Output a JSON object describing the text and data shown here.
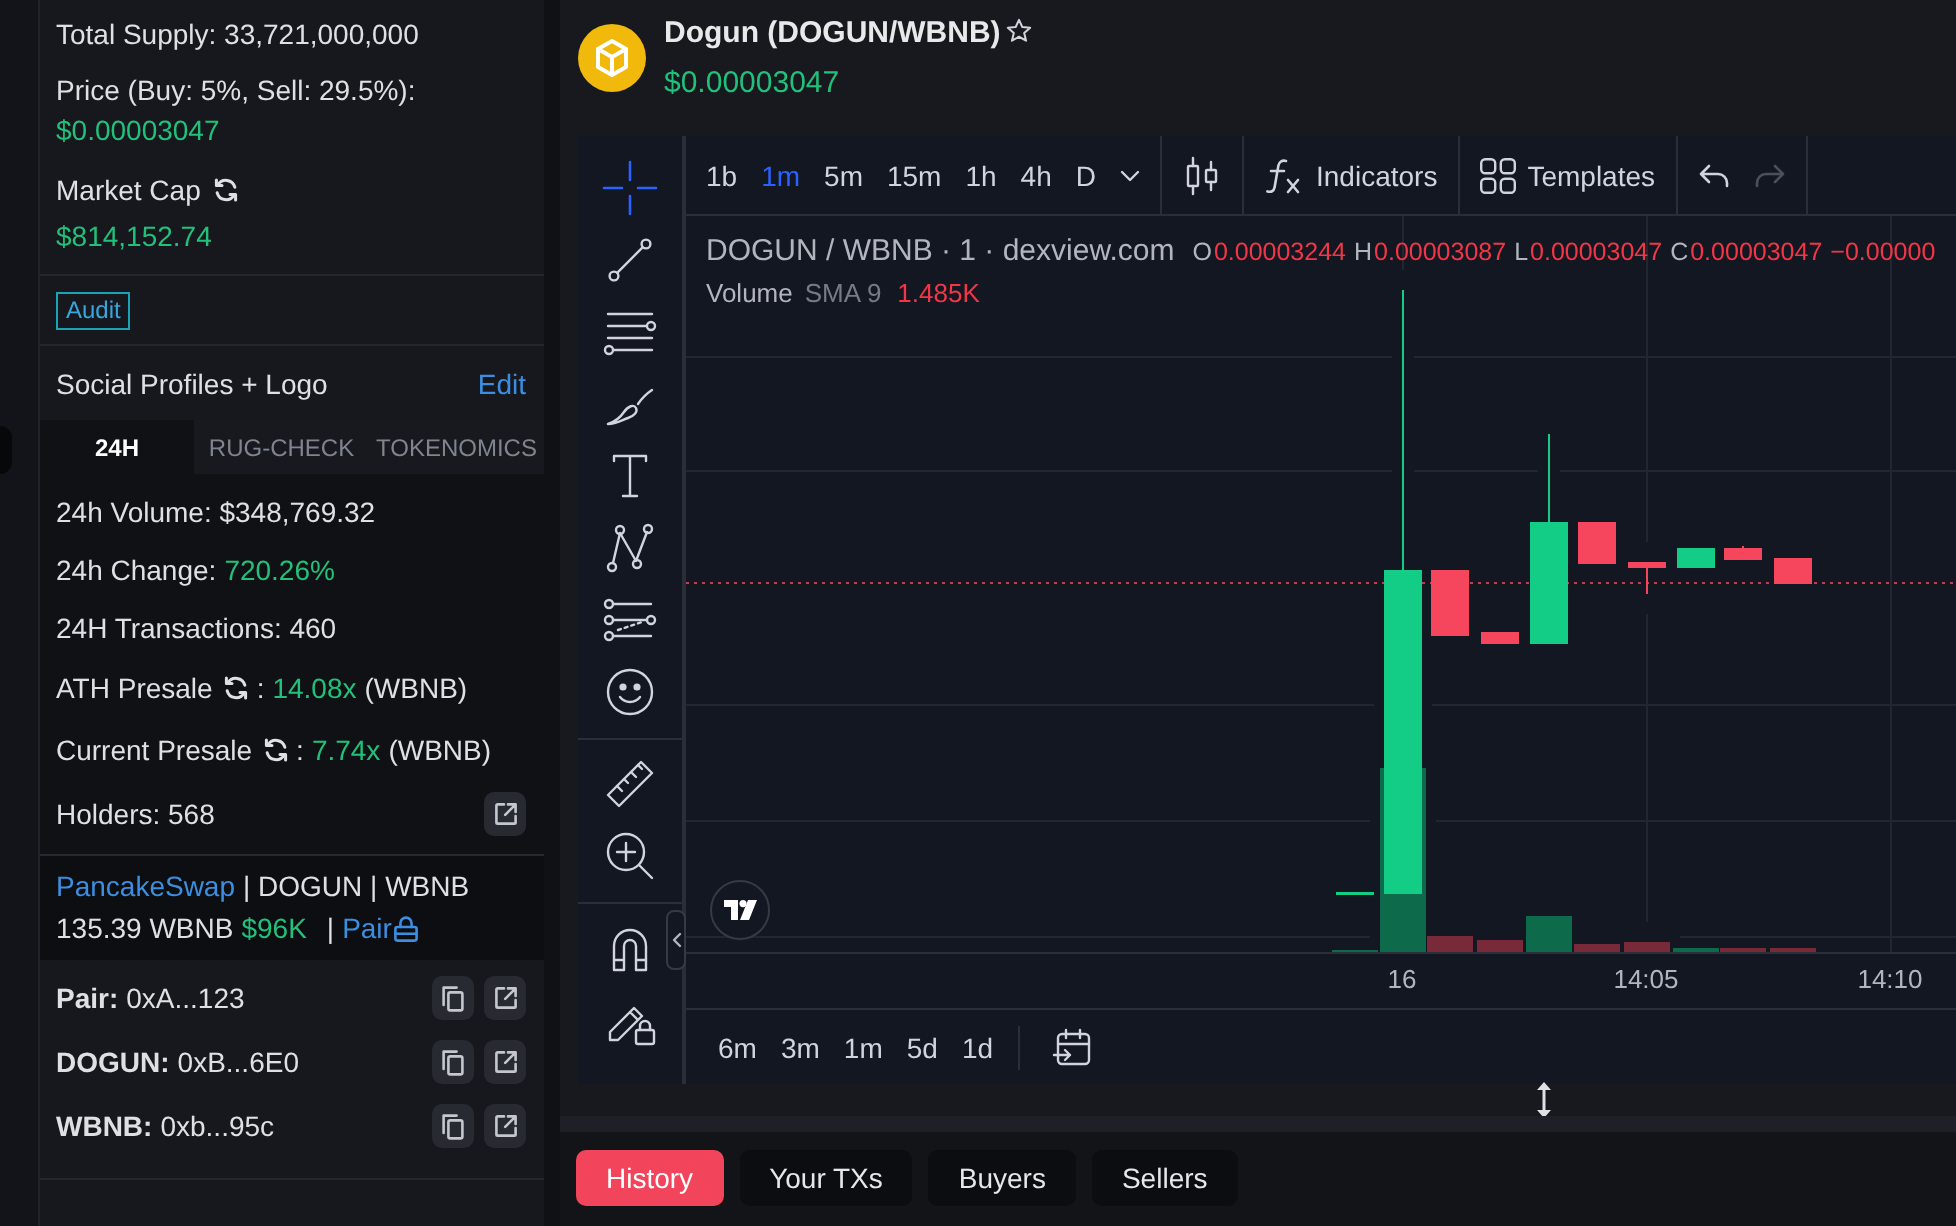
{
  "left_panel": {
    "total_supply": "Total Supply: 33,721,000,000",
    "price_label": "Price (Buy: 5%, Sell: 29.5%):",
    "price": "$0.00003047",
    "market_cap_label": "Market Cap",
    "market_cap": "$814,152.74",
    "audit_badge": "Audit",
    "social_title": "Social Profiles + Logo",
    "edit_link": "Edit",
    "tabs": [
      {
        "label": "24H",
        "selected": true
      },
      {
        "label": "RUG-CHECK",
        "selected": false
      },
      {
        "label": "TOKENOMICS",
        "selected": false
      }
    ],
    "stats": [
      {
        "kind": "text",
        "label": "24h Volume: $348,769.32"
      },
      {
        "kind": "change",
        "label": "24h Change:",
        "value": "720.26%"
      },
      {
        "kind": "text",
        "label": "24H Transactions: 460"
      },
      {
        "kind": "presale",
        "label": "ATH Presale",
        "separator": ":",
        "value": "14.08x",
        "suffix": "(WBNB)"
      },
      {
        "kind": "presale",
        "label": "Current Presale",
        "separator": ":",
        "value": "7.74x",
        "suffix": "(WBNB)"
      },
      {
        "kind": "link",
        "label": "Holders: 568"
      }
    ],
    "pool": {
      "dex": "PancakeSwap",
      "pair_names": "| DOGUN | WBNB",
      "liquidity": "135.39 WBNB",
      "liquidity_usd": "$96K",
      "divider": "|",
      "pair_link": "Pair",
      "locked": true
    },
    "addresses": [
      {
        "name": "Pair:",
        "address": "0xA...123"
      },
      {
        "name": "DOGUN:",
        "address": "0xB...6E0"
      },
      {
        "name": "WBNB:",
        "address": "0xb...95c"
      }
    ]
  },
  "header": {
    "title": "Dogun (DOGUN/WBNB)",
    "favorite": false,
    "price": "$0.00003047"
  },
  "chart": {
    "intervals": [
      {
        "label": "1b",
        "selected": false
      },
      {
        "label": "1m",
        "selected": true
      },
      {
        "label": "5m",
        "selected": false
      },
      {
        "label": "15m",
        "selected": false
      },
      {
        "label": "1h",
        "selected": false
      },
      {
        "label": "4h",
        "selected": false
      },
      {
        "label": "D",
        "selected": false
      }
    ],
    "indicators": "Indicators",
    "templates": "Templates",
    "undo_disabled": false,
    "redo_disabled": true,
    "tool_groups": [
      [
        {
          "kind": "crosshair",
          "selected": true
        },
        {
          "kind": "trend-line",
          "selected": false
        },
        {
          "kind": "fib",
          "selected": false
        },
        {
          "kind": "brush",
          "selected": false
        },
        {
          "kind": "text",
          "selected": false
        },
        {
          "kind": "pattern",
          "selected": false
        },
        {
          "kind": "forecast",
          "selected": false
        },
        {
          "kind": "emoji",
          "selected": false
        }
      ],
      [
        {
          "kind": "ruler",
          "selected": false
        },
        {
          "kind": "zoom",
          "selected": false
        }
      ],
      [
        {
          "kind": "magnet",
          "selected": false
        },
        {
          "kind": "lock-drawings",
          "selected": false
        }
      ]
    ],
    "legend": {
      "symbol": "DOGUN / WBNB · 1 · dexview.com",
      "ohlc": [
        {
          "key": "O",
          "value": "0.00003244"
        },
        {
          "key": "H",
          "value": "0.00003087"
        },
        {
          "key": "L",
          "value": "0.00003047"
        },
        {
          "key": "C",
          "value": "0.00003047"
        }
      ],
      "change": "−0.00000"
    },
    "volume": {
      "name": "Volume",
      "params": "SMA 9",
      "value": "1.485K"
    },
    "time_labels": [
      "16",
      "14:05",
      "14:10"
    ],
    "ranges": [
      "6m",
      "3m",
      "1m",
      "5d",
      "1d"
    ]
  },
  "bottom_tabs": [
    {
      "label": "History",
      "selected": true
    },
    {
      "label": "Your TXs",
      "selected": false
    },
    {
      "label": "Buyers",
      "selected": false
    },
    {
      "label": "Sellers",
      "selected": false
    }
  ]
}
